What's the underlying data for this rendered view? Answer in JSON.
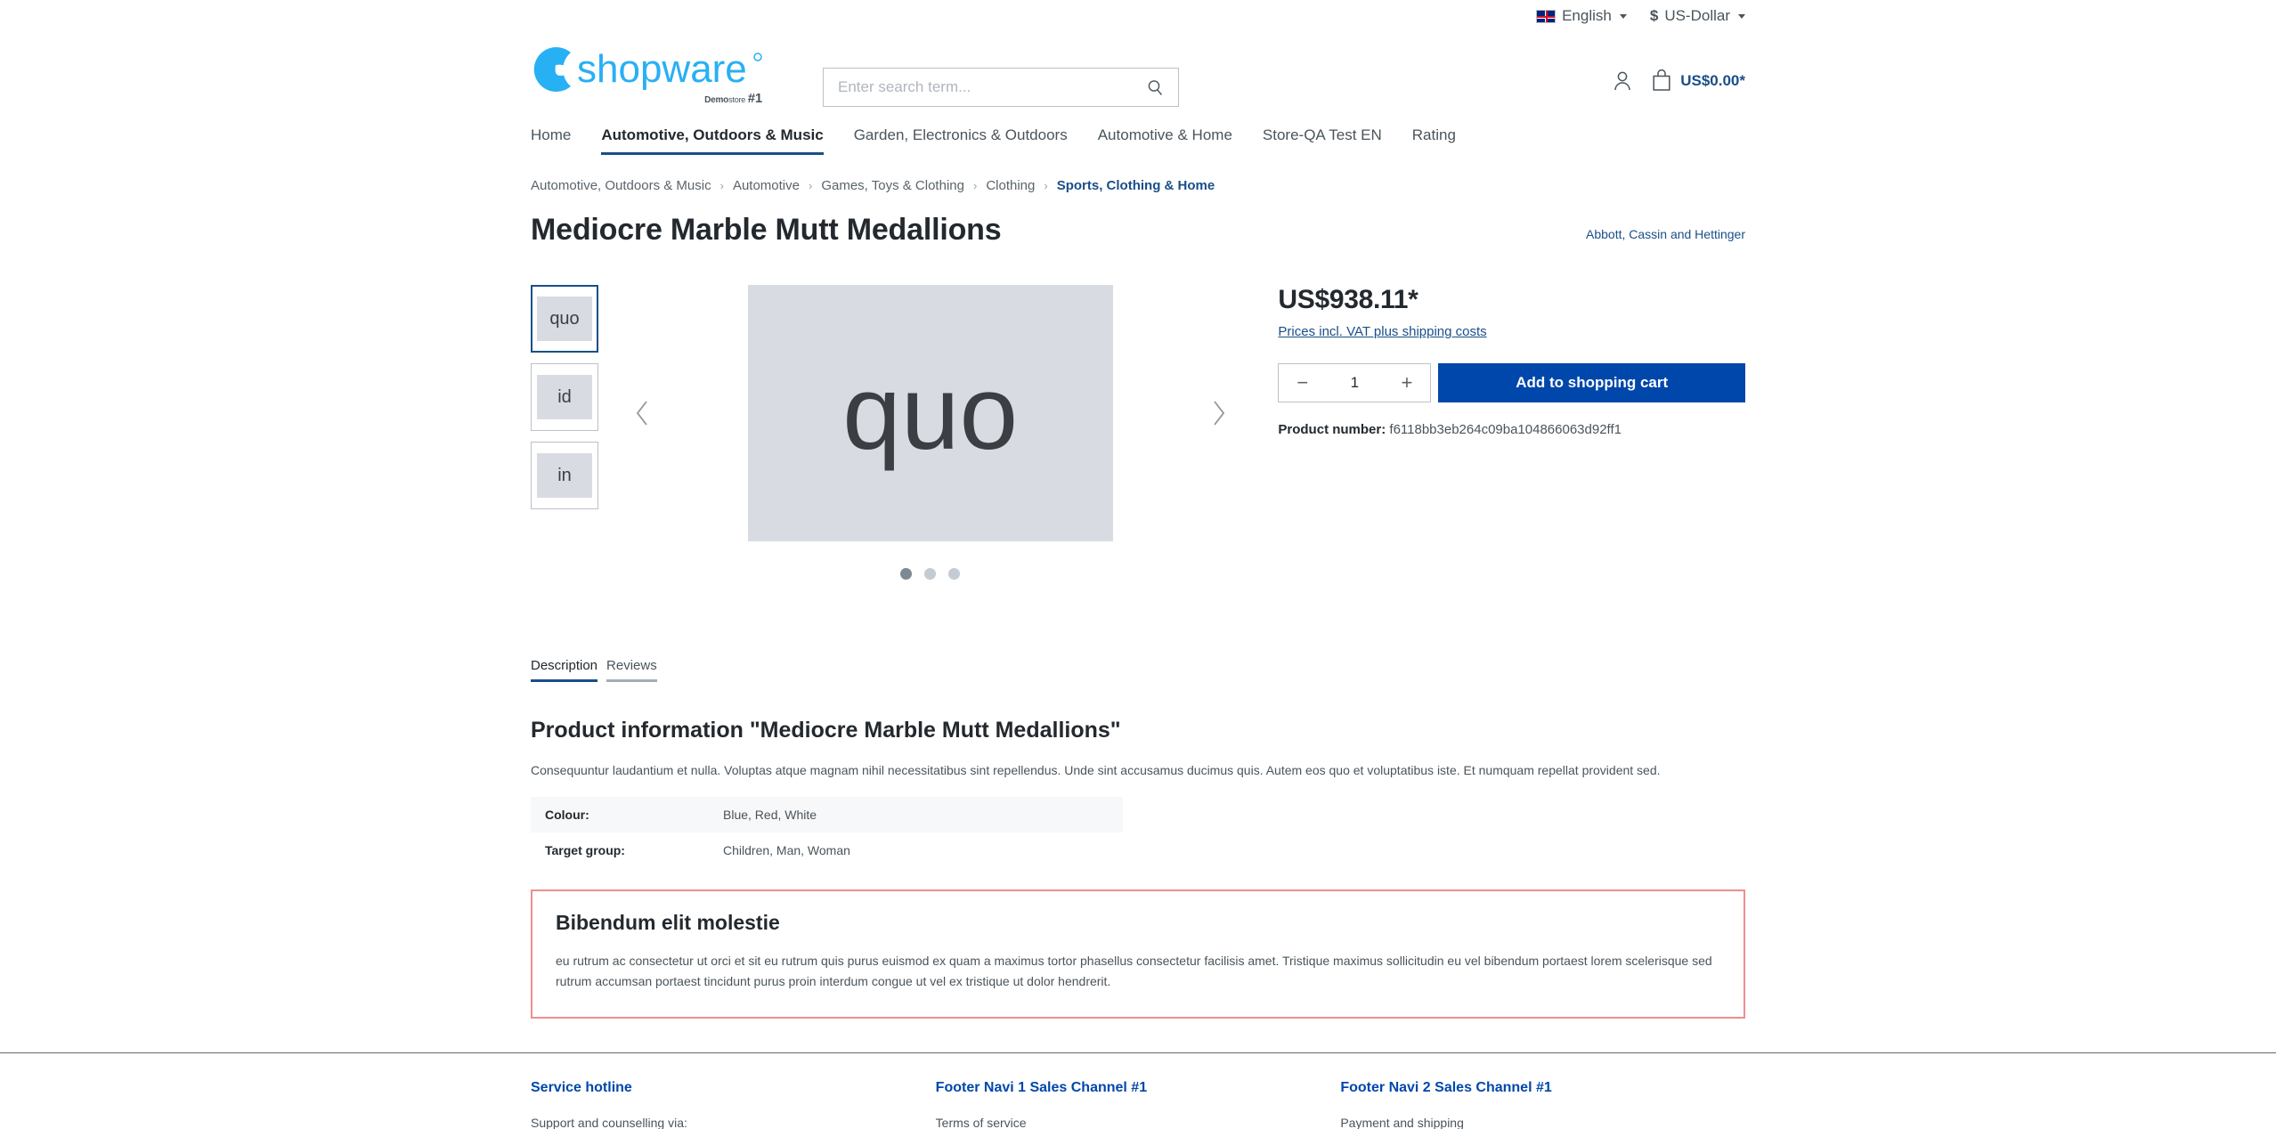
{
  "topbar": {
    "language": "English",
    "language_icon": "uk-flag-icon",
    "currency": "US-Dollar",
    "currency_symbol": "$"
  },
  "header": {
    "logo_text": "shopware",
    "logo_sub_demo": "Demo",
    "logo_sub_store": "store",
    "logo_sub_num": "#1",
    "search": {
      "placeholder": "Enter search term...",
      "value": "",
      "icon": "search-icon"
    },
    "account_icon": "user-icon",
    "cart_icon": "shopping-bag-icon",
    "cart_amount": "US$0.00*"
  },
  "nav": {
    "items": [
      {
        "label": "Home",
        "active": false
      },
      {
        "label": "Automotive, Outdoors & Music",
        "active": true
      },
      {
        "label": "Garden, Electronics & Outdoors",
        "active": false
      },
      {
        "label": "Automotive & Home",
        "active": false
      },
      {
        "label": "Store-QA Test EN",
        "active": false
      },
      {
        "label": "Rating",
        "active": false
      }
    ]
  },
  "breadcrumb": {
    "separator": "›",
    "items": [
      {
        "label": "Automotive, Outdoors & Music",
        "current": false
      },
      {
        "label": "Automotive",
        "current": false
      },
      {
        "label": "Games, Toys & Clothing",
        "current": false
      },
      {
        "label": "Clothing",
        "current": false
      },
      {
        "label": "Sports, Clothing & Home",
        "current": true
      }
    ]
  },
  "product": {
    "title": "Mediocre Marble Mutt Medallions",
    "manufacturer": "Abbott, Cassin and Hettinger",
    "gallery": {
      "thumbnails": [
        {
          "label": "quo",
          "active": true
        },
        {
          "label": "id",
          "active": false
        },
        {
          "label": "in",
          "active": false
        }
      ],
      "main_image_label": "quo",
      "prev_icon": "chevron-left-icon",
      "next_icon": "chevron-right-icon",
      "dots": [
        {
          "active": true
        },
        {
          "active": false
        },
        {
          "active": false
        }
      ]
    },
    "price": "US$938.11*",
    "tax_note": "Prices incl. VAT plus shipping costs",
    "quantity": "1",
    "decrease_label": "−",
    "increase_label": "+",
    "add_to_cart_label": "Add to shopping cart",
    "product_number_label": "Product number:",
    "product_number": "f6118bb3eb264c09ba104866063d92ff1"
  },
  "tabs": [
    {
      "label": "Description",
      "active": true
    },
    {
      "label": "Reviews",
      "active": false
    }
  ],
  "description": {
    "heading": "Product information \"Mediocre Marble Mutt Medallions\"",
    "text": "Consequuntur laudantium et nulla. Voluptas atque magnam nihil necessitatibus sint repellendus. Unde sint accusamus ducimus quis. Autem eos quo et voluptatibus iste. Et numquam repellat provident sed.",
    "properties": [
      {
        "label": "Colour:",
        "value": "Blue, Red, White"
      },
      {
        "label": "Target group:",
        "value": "Children, Man, Woman"
      }
    ]
  },
  "highlight": {
    "heading": "Bibendum elit molestie",
    "text": "eu rutrum ac consectetur ut orci et sit eu rutrum quis purus euismod ex quam a maximus tortor phasellus consectetur facilisis amet. Tristique maximus sollicitudin eu vel bibendum portaest lorem scelerisque sed rutrum accumsan portaest tincidunt purus proin interdum congue ut vel ex tristique ut dolor hendrerit.",
    "border_color": "#ef8e8e"
  },
  "footer": {
    "columns": [
      {
        "heading": "Service hotline",
        "link": "Support and counselling via:"
      },
      {
        "heading": "Footer Navi 1 Sales Channel #1",
        "link": "Terms of service"
      },
      {
        "heading": "Footer Navi 2 Sales Channel #1",
        "link": "Payment and shipping"
      }
    ]
  },
  "colors": {
    "brand_blue": "#0047ab",
    "link_blue": "#1a4e8a",
    "logo_blue": "#28b0f4",
    "image_placeholder": "#d8dce2"
  }
}
